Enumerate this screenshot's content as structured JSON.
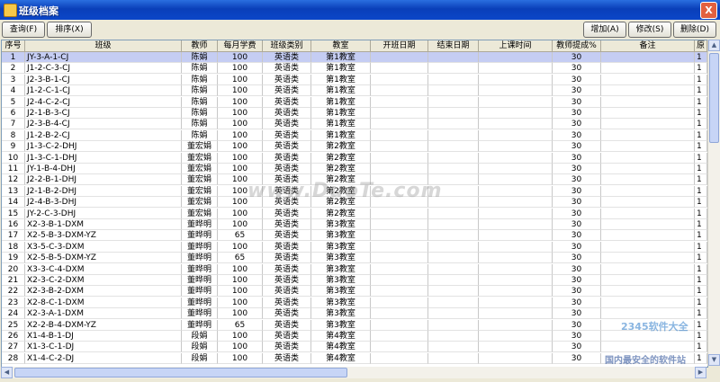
{
  "window": {
    "title": "班级档案",
    "close_label": "X"
  },
  "toolbar": {
    "query": "查询(F)",
    "sort": "排序(X)",
    "add": "增加(A)",
    "edit": "修改(S)",
    "delete": "删除(D)"
  },
  "table": {
    "columns": [
      "序号",
      "班级",
      "教师",
      "每月学费",
      "班级类别",
      "教室",
      "开班日期",
      "结束日期",
      "上课时间",
      "教师提成%",
      "备注",
      "原"
    ],
    "rows": [
      [
        "1",
        "JY-3-A-1-CJ",
        "陈娟",
        "100",
        "英语类",
        "第1教室",
        "",
        "",
        "",
        "30",
        "",
        "1"
      ],
      [
        "2",
        "J1-2-C-3-CJ",
        "陈娟",
        "100",
        "英语类",
        "第1教室",
        "",
        "",
        "",
        "30",
        "",
        "1"
      ],
      [
        "3",
        "J2-3-B-1-CJ",
        "陈娟",
        "100",
        "英语类",
        "第1教室",
        "",
        "",
        "",
        "30",
        "",
        "1"
      ],
      [
        "4",
        "J1-2-C-1-CJ",
        "陈娟",
        "100",
        "英语类",
        "第1教室",
        "",
        "",
        "",
        "30",
        "",
        "1"
      ],
      [
        "5",
        "J2-4-C-2-CJ",
        "陈娟",
        "100",
        "英语类",
        "第1教室",
        "",
        "",
        "",
        "30",
        "",
        "1"
      ],
      [
        "6",
        "J2-1-B-3-CJ",
        "陈娟",
        "100",
        "英语类",
        "第1教室",
        "",
        "",
        "",
        "30",
        "",
        "1"
      ],
      [
        "7",
        "J2-3-B-4-CJ",
        "陈娟",
        "100",
        "英语类",
        "第1教室",
        "",
        "",
        "",
        "30",
        "",
        "1"
      ],
      [
        "8",
        "J1-2-B-2-CJ",
        "陈娟",
        "100",
        "英语类",
        "第1教室",
        "",
        "",
        "",
        "30",
        "",
        "1"
      ],
      [
        "9",
        "J1-3-C-2-DHJ",
        "董宏娟",
        "100",
        "英语类",
        "第2教室",
        "",
        "",
        "",
        "30",
        "",
        "1"
      ],
      [
        "10",
        "J1-3-C-1-DHJ",
        "董宏娟",
        "100",
        "英语类",
        "第2教室",
        "",
        "",
        "",
        "30",
        "",
        "1"
      ],
      [
        "11",
        "JY-1-B-4-DHJ",
        "董宏娟",
        "100",
        "英语类",
        "第2教室",
        "",
        "",
        "",
        "30",
        "",
        "1"
      ],
      [
        "12",
        "J2-2-B-1-DHJ",
        "董宏娟",
        "100",
        "英语类",
        "第2教室",
        "",
        "",
        "",
        "30",
        "",
        "1"
      ],
      [
        "13",
        "J2-1-B-2-DHJ",
        "董宏娟",
        "100",
        "英语类",
        "第2教室",
        "",
        "",
        "",
        "30",
        "",
        "1"
      ],
      [
        "14",
        "J2-4-B-3-DHJ",
        "董宏娟",
        "100",
        "英语类",
        "第2教室",
        "",
        "",
        "",
        "30",
        "",
        "1"
      ],
      [
        "15",
        "JY-2-C-3-DHJ",
        "董宏娟",
        "100",
        "英语类",
        "第2教室",
        "",
        "",
        "",
        "30",
        "",
        "1"
      ],
      [
        "16",
        "X2-3-B-1-DXM",
        "董晔明",
        "100",
        "英语类",
        "第3教室",
        "",
        "",
        "",
        "30",
        "",
        "1"
      ],
      [
        "17",
        "X2-5-B-3-DXM-YZ",
        "董晔明",
        "65",
        "英语类",
        "第3教室",
        "",
        "",
        "",
        "30",
        "",
        "1"
      ],
      [
        "18",
        "X3-5-C-3-DXM",
        "董晔明",
        "100",
        "英语类",
        "第3教室",
        "",
        "",
        "",
        "30",
        "",
        "1"
      ],
      [
        "19",
        "X2-5-B-5-DXM-YZ",
        "董晔明",
        "65",
        "英语类",
        "第3教室",
        "",
        "",
        "",
        "30",
        "",
        "1"
      ],
      [
        "20",
        "X3-3-C-4-DXM",
        "董晔明",
        "100",
        "英语类",
        "第3教室",
        "",
        "",
        "",
        "30",
        "",
        "1"
      ],
      [
        "21",
        "X2-3-C-2-DXM",
        "董晔明",
        "100",
        "英语类",
        "第3教室",
        "",
        "",
        "",
        "30",
        "",
        "1"
      ],
      [
        "22",
        "X2-3-B-2-DXM",
        "董晔明",
        "100",
        "英语类",
        "第3教室",
        "",
        "",
        "",
        "30",
        "",
        "1"
      ],
      [
        "23",
        "X2-8-C-1-DXM",
        "董晔明",
        "100",
        "英语类",
        "第3教室",
        "",
        "",
        "",
        "30",
        "",
        "1"
      ],
      [
        "24",
        "X2-3-A-1-DXM",
        "董晔明",
        "100",
        "英语类",
        "第3教室",
        "",
        "",
        "",
        "30",
        "",
        "1"
      ],
      [
        "25",
        "X2-2-B-4-DXM-YZ",
        "董晔明",
        "65",
        "英语类",
        "第3教室",
        "",
        "",
        "",
        "30",
        "",
        "1"
      ],
      [
        "26",
        "X1-4-B-1-DJ",
        "段娟",
        "100",
        "英语类",
        "第4教室",
        "",
        "",
        "",
        "30",
        "",
        "1"
      ],
      [
        "27",
        "X1-3-C-1-DJ",
        "段娟",
        "100",
        "英语类",
        "第4教室",
        "",
        "",
        "",
        "30",
        "",
        "1"
      ],
      [
        "28",
        "X1-4-C-2-DJ",
        "段娟",
        "100",
        "英语类",
        "第4教室",
        "",
        "",
        "",
        "30",
        "",
        "1"
      ]
    ]
  },
  "watermarks": {
    "center": "www.DuoTe.com",
    "brand": "2345软件大全",
    "slogan": "国内最安全的软件站"
  }
}
